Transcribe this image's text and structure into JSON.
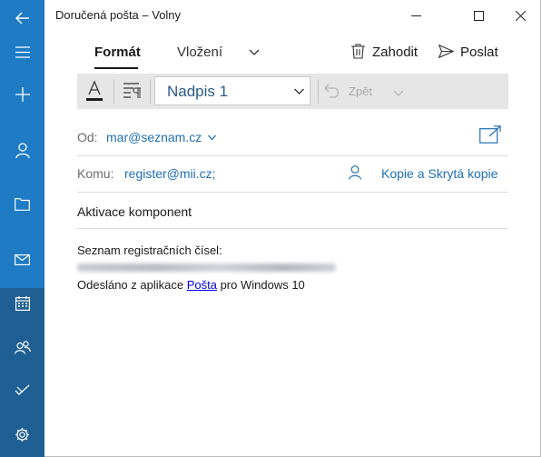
{
  "window": {
    "title": "Doručená pošta – Volny"
  },
  "ribbon": {
    "tabs": [
      {
        "label": "Formát"
      },
      {
        "label": "Vložení"
      }
    ],
    "discard_label": "Zahodit",
    "send_label": "Poslat"
  },
  "toolbar": {
    "style_value": "Nadpis 1",
    "undo_label": "Zpět"
  },
  "from": {
    "label": "Od:",
    "value": "mar@seznam.cz"
  },
  "to": {
    "label": "Komu:",
    "value": "register@mii.cz;",
    "cc_bcc_label": "Kopie a Skrytá kopie"
  },
  "subject": "Aktivace komponent",
  "body": {
    "line1": "Seznam registračních čísel:",
    "sig_prefix": "Odesláno z aplikace",
    "sig_link": "Pošta",
    "sig_suffix": "pro Windows 10"
  },
  "colors": {
    "sidebar": "#1e7bc4",
    "sidebar_bottom": "#1f5f93",
    "accent": "#1f6fb5"
  }
}
